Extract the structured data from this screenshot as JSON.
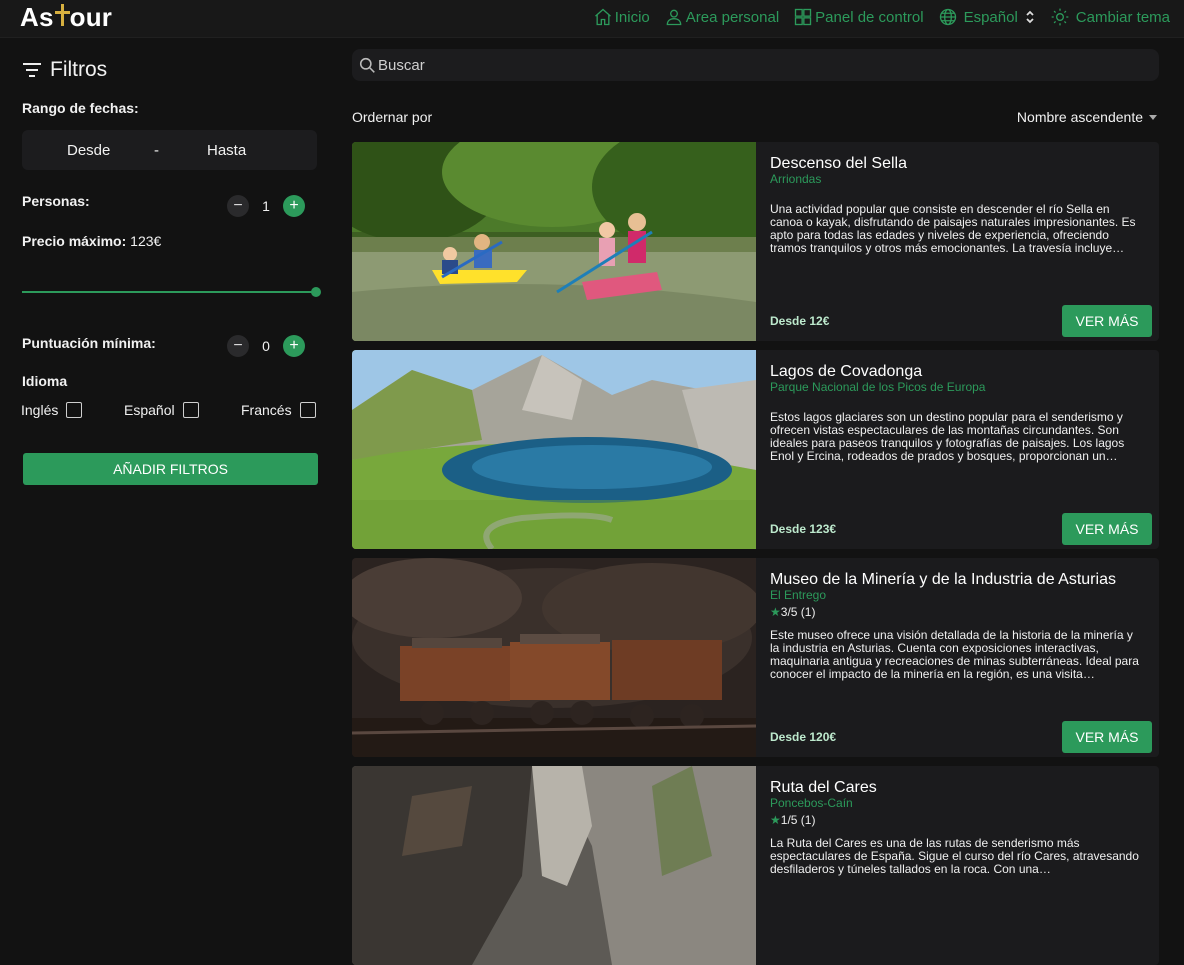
{
  "header": {
    "logo_text": [
      "As",
      "our"
    ],
    "nav": [
      {
        "label": "Inicio",
        "icon": "home-icon"
      },
      {
        "label": "Area personal",
        "icon": "user-icon"
      },
      {
        "label": "Panel de control",
        "icon": "dashboard-icon"
      },
      {
        "label": "Español",
        "icon": "globe-icon"
      },
      {
        "label": "Cambiar tema",
        "icon": "sun-icon"
      }
    ]
  },
  "filters": {
    "title": "Filtros",
    "date_range_label": "Rango de fechas:",
    "date_from": "Desde",
    "date_sep": "-",
    "date_to": "Hasta",
    "people_label": "Personas:",
    "people_value": "1",
    "max_price_label": "Precio máximo:",
    "max_price_value": "123€",
    "max_price_slider_fraction": 1.0,
    "min_score_label": "Puntuación mínima:",
    "min_score_value": "0",
    "language_label": "Idioma",
    "languages": [
      "Inglés",
      "Español",
      "Francés"
    ],
    "add_button": "AÑADIR FILTROS"
  },
  "search": {
    "placeholder": "Buscar"
  },
  "sort": {
    "label": "Ordernar por",
    "selected": "Nombre ascendente"
  },
  "accent_color": "#2c9a5b",
  "cards": [
    {
      "title": "Descenso del Sella",
      "location": "Arriondas",
      "rating": "",
      "description": "Una actividad popular que consiste en descender el río Sella en canoa o kayak, disfrutando de paisajes naturales impresionantes. Es apto para todas las edades y niveles de experiencia, ofreciendo tramos tranquilos y otros más emocionantes. La travesía incluye…",
      "price": "Desde 12€",
      "button": "VER MÁS"
    },
    {
      "title": "Lagos de Covadonga",
      "location": "Parque Nacional de los Picos de Europa",
      "rating": "",
      "description": "Estos lagos glaciares son un destino popular para el senderismo y ofrecen vistas espectaculares de las montañas circundantes. Son ideales para paseos tranquilos y fotografías de paisajes. Los lagos Enol y Ercina, rodeados de prados y bosques, proporcionan un…",
      "price": "Desde 123€",
      "button": "VER MÁS"
    },
    {
      "title": "Museo de la Minería y de la Industria de Asturias",
      "location": "El Entrego",
      "rating": "3/5 (1)",
      "description": "Este museo ofrece una visión detallada de la historia de la minería y la industria en Asturias. Cuenta con exposiciones interactivas, maquinaria antigua y recreaciones de minas subterráneas. Ideal para conocer el impacto de la minería en la región, es una visita…",
      "price": "Desde 120€",
      "button": "VER MÁS"
    },
    {
      "title": "Ruta del Cares",
      "location": "Poncebos-Caín",
      "rating": "1/5 (1)",
      "description": "La Ruta del Cares es una de las rutas de senderismo más espectaculares de España. Sigue el curso del río Cares, atravesando desfiladeros y túneles tallados en la roca. Con una…",
      "price": "",
      "button": ""
    }
  ]
}
